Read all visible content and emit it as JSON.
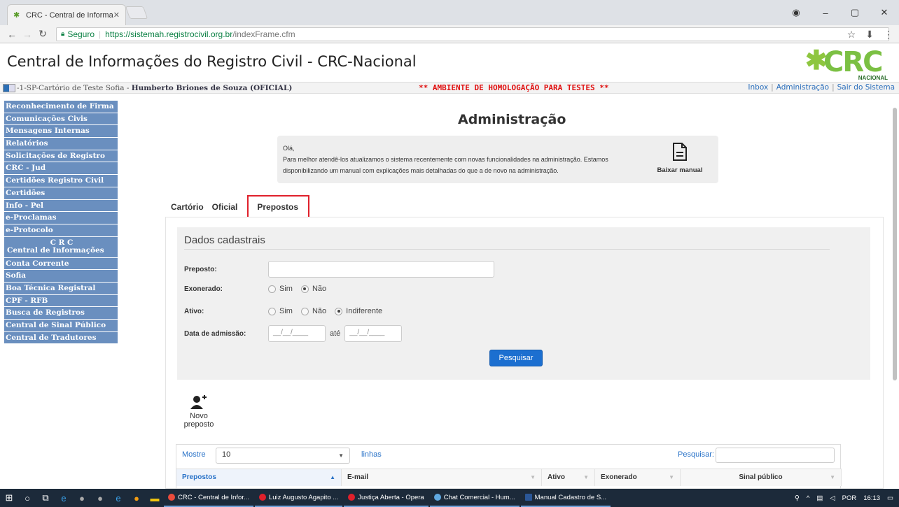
{
  "browser": {
    "tab_title": "CRC - Central de Informa",
    "secure_label": "Seguro",
    "url_host": "https://sistemah.registrocivil.org.br",
    "url_path": "/indexFrame.cfm"
  },
  "header": {
    "title": "Central de Informações do Registro Civil - CRC-Nacional",
    "logo_text": "CRC",
    "logo_sub": "NACIONAL"
  },
  "status": {
    "cartorio": "-1-SP-Cartório de Teste Sofia - ",
    "user": "Humberto Briones de Souza (OFICIAL)",
    "warning": "** AMBIENTE DE HOMOLOGAÇÃO PARA TESTES **",
    "links": [
      "Inbox",
      "Administração",
      "Sair do Sistema"
    ]
  },
  "menu": {
    "items": [
      "Reconhecimento de Firma",
      "Comunicações Civis",
      "Mensagens Internas",
      "Relatórios",
      "Solicitações de Registro",
      "CRC - Jud",
      "Certidões Registro Civil",
      "Certidões",
      "Info - Pel",
      "e-Proclamas",
      "e-Protocolo"
    ],
    "crc_line1": "C R C",
    "crc_line2": "Central de Informações",
    "items2": [
      "Conta Corrente",
      "Sofia",
      "Boa Técnica Registral",
      "CPF - RFB",
      "Busca de Registros",
      "Central de Sinal Público",
      "Central de Tradutores"
    ]
  },
  "main": {
    "page_title": "Administração",
    "notice": {
      "greeting": "Olá,",
      "line1": "Para melhor atendê-los atualizamos o sistema recentemente com novas funcionalidades na administração. Estamos",
      "line2": "disponibilizando um manual com explicações mais detalhadas do que a de novo na administração.",
      "download_label": "Baixar manual"
    },
    "tabs": [
      "Cartório",
      "Oficial",
      "Prepostos"
    ],
    "form": {
      "heading": "Dados cadastrais",
      "preposto_label": "Preposto:",
      "preposto_value": "",
      "exonerado_label": "Exonerado:",
      "exonerado_options": [
        "Sim",
        "Não"
      ],
      "exonerado_selected": "Não",
      "ativo_label": "Ativo:",
      "ativo_options": [
        "Sim",
        "Não",
        "Indiferente"
      ],
      "ativo_selected": "Indiferente",
      "admissao_label": "Data de admissão:",
      "date_placeholder": "__/__/____",
      "ate_label": "até",
      "search_button": "Pesquisar"
    },
    "new_preposto_label": "Novo preposto",
    "table": {
      "show_label": "Mostre",
      "page_size": "10",
      "rows_label": "linhas",
      "search_label": "Pesquisar:",
      "columns": [
        "Prepostos",
        "E-mail",
        "Ativo",
        "Exonerado",
        "Sinal público"
      ]
    }
  },
  "taskbar": {
    "apps": [
      "CRC - Central de Infor...",
      "Luiz Augusto Agapito ...",
      "Justiça Aberta - Opera",
      "Chat Comercial - Hum...",
      "Manual Cadastro de S..."
    ],
    "lang": "POR",
    "time": "16:13"
  }
}
